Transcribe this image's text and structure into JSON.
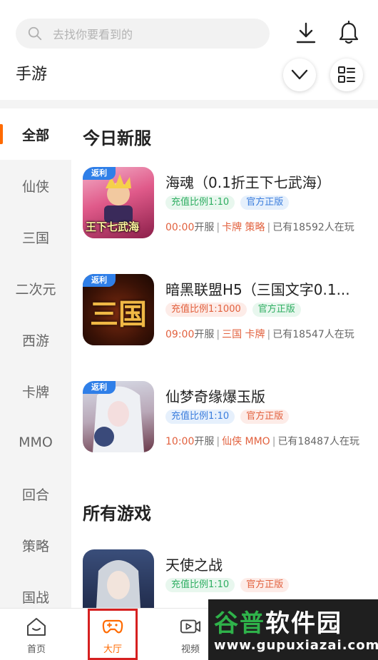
{
  "header": {
    "search_placeholder": "去找你要看到的",
    "section_title": "手游"
  },
  "sidebar": {
    "categories": [
      "全部",
      "仙侠",
      "三国",
      "二次元",
      "西游",
      "卡牌",
      "MMO",
      "回合",
      "策略",
      "国战"
    ],
    "active_index": 0
  },
  "main": {
    "today_heading": "今日新服",
    "all_heading": "所有游戏",
    "badge_label": "返利",
    "games": [
      {
        "name": "海魂（0.1折王下七武海）",
        "tags": [
          {
            "text": "充值比例1:10",
            "color": "green"
          },
          {
            "text": "官方正版",
            "color": "blue"
          }
        ],
        "time": "00:00",
        "open_label": "开服",
        "categories": "卡牌  策略",
        "players": "已有18592人在玩",
        "cover_text": "王下七武海",
        "has_badge": true
      },
      {
        "name": "暗黑联盟H5（三国文字0.1...",
        "tags": [
          {
            "text": "充值比例1:1000",
            "color": "orange"
          },
          {
            "text": "官方正版",
            "color": "green"
          }
        ],
        "time": "09:00",
        "open_label": "开服",
        "categories": "三国  卡牌",
        "players": "已有18547人在玩",
        "cover_text": "三国",
        "has_badge": true
      },
      {
        "name": "仙梦奇缘爆玉版",
        "tags": [
          {
            "text": "充值比例1:10",
            "color": "blue"
          },
          {
            "text": "官方正版",
            "color": "orange"
          }
        ],
        "time": "10:00",
        "open_label": "开服",
        "categories": "仙侠  MMO",
        "players": "已有18487人在玩",
        "cover_text": "",
        "has_badge": true
      },
      {
        "name": "天使之战",
        "tags": [
          {
            "text": "充值比例1:10",
            "color": "green"
          },
          {
            "text": "官方正版",
            "color": "orange"
          }
        ],
        "time": "",
        "open_label": "",
        "categories": "",
        "players": "",
        "cover_text": "",
        "has_badge": false
      }
    ]
  },
  "bottom_nav": {
    "items": [
      {
        "label": "首页",
        "icon": "home-icon"
      },
      {
        "label": "大厅",
        "icon": "gamepad-icon"
      },
      {
        "label": "视频",
        "icon": "video-icon"
      }
    ],
    "active_index": 1
  },
  "watermark": {
    "title_part1": "谷普",
    "title_part2": "软件园",
    "url": "www.gupuxiazai.com"
  },
  "colors": {
    "accent": "#ff6a00",
    "highlight_box": "#d62020",
    "badge": "#2f7fe8"
  }
}
